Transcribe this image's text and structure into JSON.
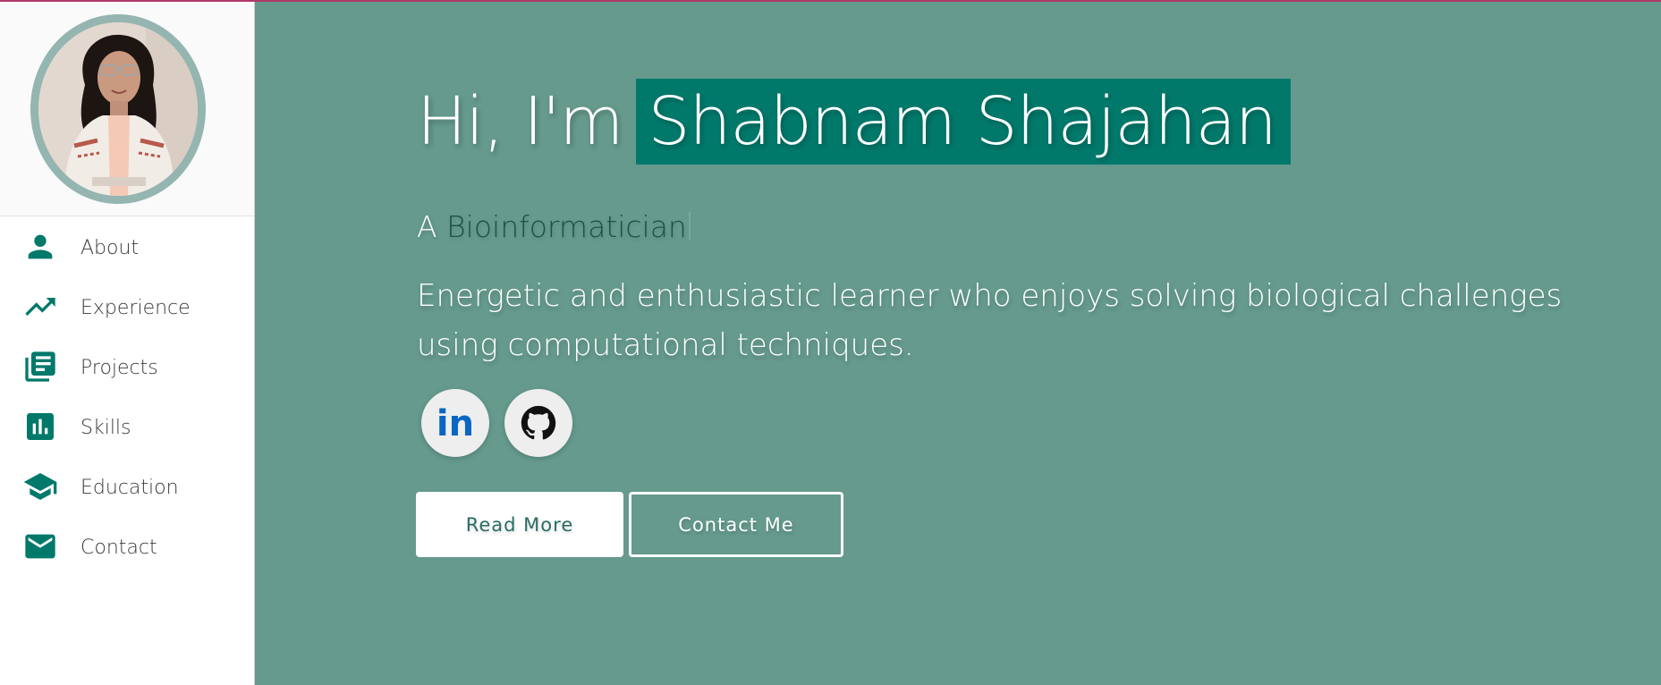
{
  "colors": {
    "accent": "#00796b",
    "hero_bg": "#659a8d",
    "sidebar_bg": "#ffffff",
    "top_strip": "#b0386b"
  },
  "sidebar": {
    "avatar": {
      "icon": "profile-photo"
    },
    "items": [
      {
        "label": "About",
        "icon": "person-icon"
      },
      {
        "label": "Experience",
        "icon": "trending-up-icon"
      },
      {
        "label": "Projects",
        "icon": "library-books-icon"
      },
      {
        "label": "Skills",
        "icon": "bar-chart-icon"
      },
      {
        "label": "Education",
        "icon": "school-icon"
      },
      {
        "label": "Contact",
        "icon": "mail-icon"
      }
    ]
  },
  "hero": {
    "greeting": "Hi, I'm",
    "name": "Shabnam Shajahan",
    "tagline_prefix": "A",
    "tagline_role": "Bioinformatician",
    "bio": "Energetic and enthusiastic learner who enjoys solving biological challenges using computational techniques.",
    "social": [
      {
        "name": "LinkedIn",
        "icon": "linkedin-icon",
        "glyph": "in"
      },
      {
        "name": "GitHub",
        "icon": "github-icon"
      }
    ],
    "buttons": {
      "read_more": "Read More",
      "contact_me": "Contact Me"
    }
  }
}
